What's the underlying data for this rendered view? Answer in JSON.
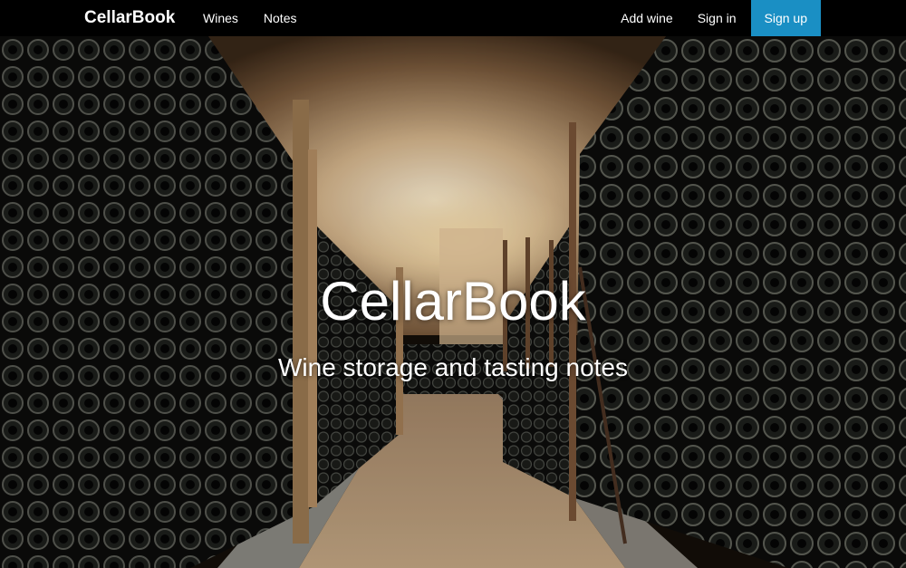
{
  "navbar": {
    "brand": "CellarBook",
    "left_links": [
      "Wines",
      "Notes"
    ],
    "right_links": {
      "add": "Add wine",
      "signin": "Sign in",
      "signup": "Sign up"
    },
    "signup_color": "#1a8fc4"
  },
  "hero": {
    "title": "CellarBook",
    "subtitle": "Wine storage and tasting notes",
    "background": "wine cellar photo with bottle racks and vaulted stone ceiling"
  }
}
